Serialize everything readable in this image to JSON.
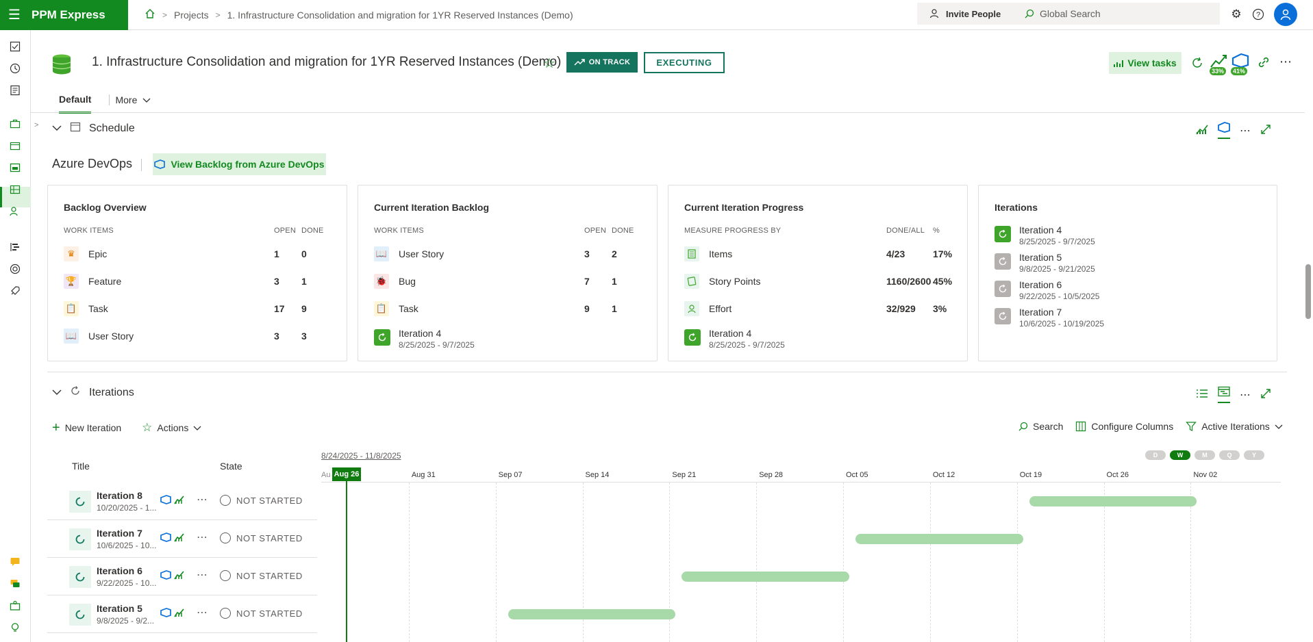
{
  "topbar": {
    "brand": "PPM Express",
    "breadcrumb": [
      "Projects",
      "1. Infrastructure Consolidation and migration for 1YR Reserved Instances (Demo)"
    ],
    "invite_label": "Invite People",
    "search_placeholder": "Global Search"
  },
  "header": {
    "title": "1. Infrastructure Consolidation and migration for 1YR Reserved Instances (Demo)",
    "status_label": "ON TRACK",
    "stage_label": "EXECUTING",
    "view_tasks_label": "View tasks",
    "badge_progress_1": "33%",
    "badge_progress_2": "41%",
    "tabs": {
      "default": "Default",
      "more": "More"
    }
  },
  "schedule": {
    "section_title": "Schedule",
    "source_title": "Azure DevOps",
    "backlog_button": "View Backlog from Azure DevOps",
    "backlog_overview": {
      "title": "Backlog Overview",
      "col_items": "WORK ITEMS",
      "col_open": "OPEN",
      "col_done": "DONE",
      "rows": [
        {
          "label": "Epic",
          "open": "1",
          "done": "0"
        },
        {
          "label": "Feature",
          "open": "3",
          "done": "1"
        },
        {
          "label": "Task",
          "open": "17",
          "done": "9"
        },
        {
          "label": "User Story",
          "open": "3",
          "done": "3"
        }
      ]
    },
    "current_backlog": {
      "title": "Current Iteration Backlog",
      "col_items": "WORK ITEMS",
      "col_open": "OPEN",
      "col_done": "DONE",
      "rows": [
        {
          "label": "User Story",
          "open": "3",
          "done": "2"
        },
        {
          "label": "Bug",
          "open": "7",
          "done": "1"
        },
        {
          "label": "Task",
          "open": "9",
          "done": "1"
        }
      ],
      "iteration": {
        "name": "Iteration 4",
        "dates": "8/25/2025 - 9/7/2025"
      }
    },
    "current_progress": {
      "title": "Current Iteration Progress",
      "col_measure": "MEASURE PROGRESS BY",
      "col_doneall": "DONE/ALL",
      "col_pct": "%",
      "rows": [
        {
          "label": "Items",
          "doneall": "4/23",
          "pct": "17%"
        },
        {
          "label": "Story Points",
          "doneall": "1160/2600",
          "pct": "45%"
        },
        {
          "label": "Effort",
          "doneall": "32/929",
          "pct": "3%"
        }
      ],
      "iteration": {
        "name": "Iteration 4",
        "dates": "8/25/2025 - 9/7/2025"
      }
    },
    "iterations_card": {
      "title": "Iterations",
      "items": [
        {
          "name": "Iteration 4",
          "dates": "8/25/2025 - 9/7/2025"
        },
        {
          "name": "Iteration 5",
          "dates": "9/8/2025 - 9/21/2025"
        },
        {
          "name": "Iteration 6",
          "dates": "9/22/2025 - 10/5/2025"
        },
        {
          "name": "Iteration 7",
          "dates": "10/6/2025 - 10/19/2025"
        }
      ]
    }
  },
  "iterations": {
    "section_title": "Iterations",
    "new_iteration": "New Iteration",
    "actions": "Actions",
    "search": "Search",
    "configure_columns": "Configure Columns",
    "filter": "Active Iterations",
    "col_title": "Title",
    "col_state": "State",
    "date_range": "8/24/2025 - 11/8/2025",
    "scales": [
      "D",
      "W",
      "M",
      "Q",
      "Y"
    ],
    "timeline_first": "Au",
    "today_label": "Aug 26",
    "ticks": [
      "Aug 31",
      "Sep 07",
      "Sep 14",
      "Sep 21",
      "Sep 28",
      "Oct 05",
      "Oct 12",
      "Oct 19",
      "Oct 26",
      "Nov 02"
    ],
    "rows": [
      {
        "name": "Iteration 8",
        "dates": "10/20/2025 - 1...",
        "state": "NOT STARTED",
        "start": "2025-10-20",
        "end": "2025-11-02"
      },
      {
        "name": "Iteration 7",
        "dates": "10/6/2025 - 10...",
        "state": "NOT STARTED",
        "start": "2025-10-06",
        "end": "2025-10-19"
      },
      {
        "name": "Iteration 6",
        "dates": "9/22/2025 - 10...",
        "state": "NOT STARTED",
        "start": "2025-09-22",
        "end": "2025-10-05"
      },
      {
        "name": "Iteration 5",
        "dates": "9/8/2025 - 9/2...",
        "state": "NOT STARTED",
        "start": "2025-09-08",
        "end": "2025-09-21"
      }
    ]
  },
  "colors": {
    "brand": "#128a1f",
    "status": "#15745e",
    "bar": "#a8d9a8",
    "azure": "#0b6fd9"
  }
}
